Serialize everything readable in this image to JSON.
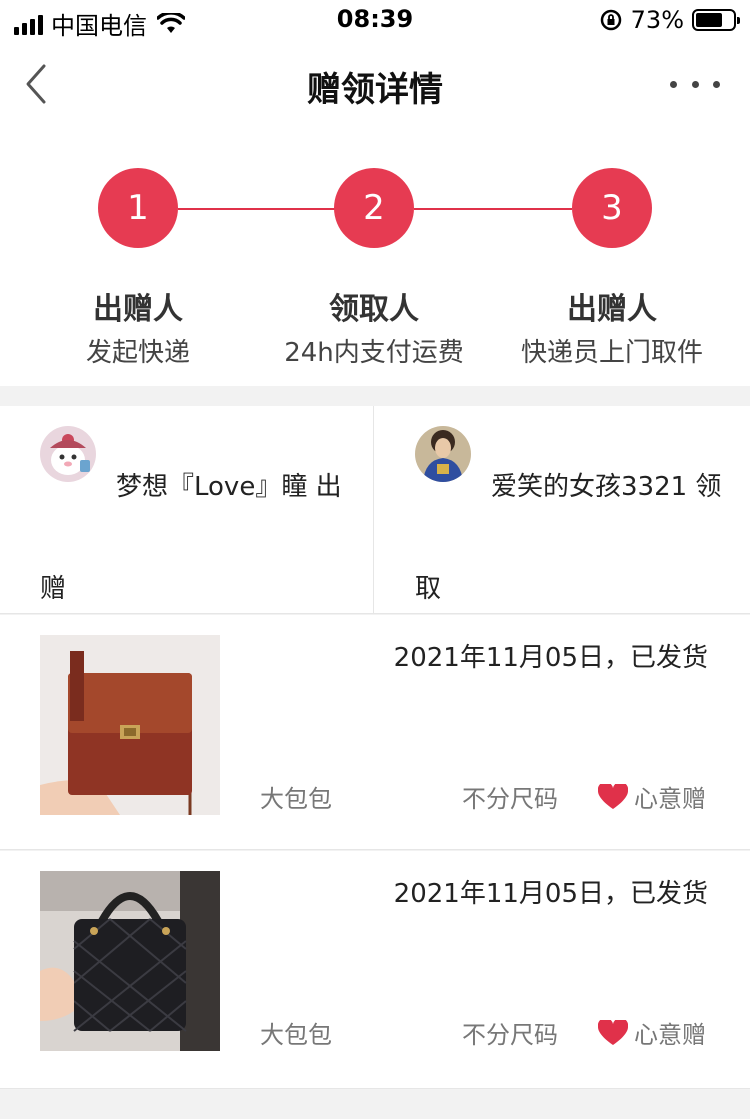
{
  "status_bar": {
    "carrier": "中国电信",
    "time": "08:39",
    "battery": "73%",
    "battery_level": 0.73
  },
  "nav": {
    "title": "赠领详情",
    "back_icon": "chevron-left-icon",
    "more_icon": "more-icon"
  },
  "steps": [
    {
      "number": "1",
      "title": "出赠人",
      "desc": "发起快递"
    },
    {
      "number": "2",
      "title": "领取人",
      "desc": "24h内支付运费"
    },
    {
      "number": "3",
      "title": "出赠人",
      "desc": "快递员上门取件"
    }
  ],
  "people": {
    "giver": {
      "text": "梦想『Love』瞳 出赠"
    },
    "receiver": {
      "text": "爱笑的女孩3321 领取"
    }
  },
  "goods": [
    {
      "status": "2021年11月05日，已发货",
      "name": "大包包",
      "size": "不分尺码",
      "tag": "心意赠"
    },
    {
      "status": "2021年11月05日，已发货",
      "name": "大包包",
      "size": "不分尺码",
      "tag": "心意赠"
    }
  ],
  "colors": {
    "accent": "#e63b52",
    "heart": "#e0314a"
  }
}
